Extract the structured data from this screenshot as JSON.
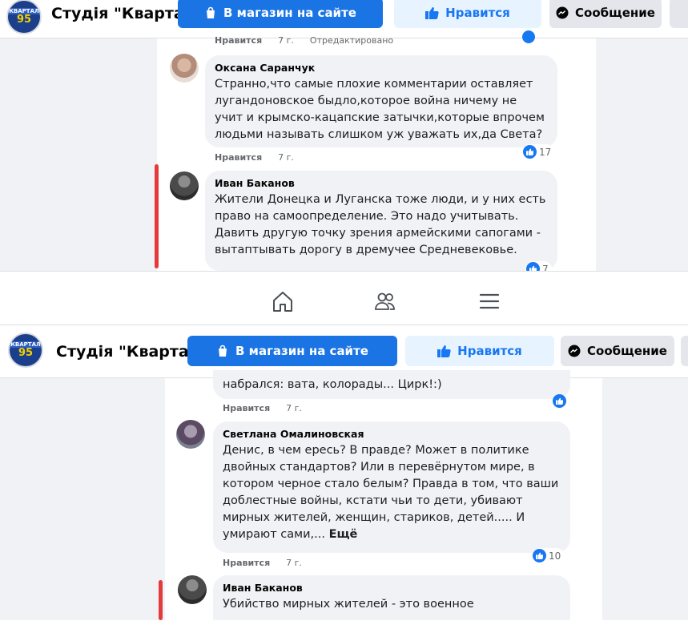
{
  "top_panel": {
    "header": {
      "page_name": "Студія \"Кварта...",
      "logo_line1": "КВАРТАЛ",
      "logo_line2": "95",
      "shop_button": "В магазин на сайте",
      "like_button": "Нравится",
      "message_button": "Сообщение"
    },
    "prev_meta": {
      "like": "Нравится",
      "time": "7 г.",
      "edited": "Отредактировано"
    },
    "comments": [
      {
        "author": "Оксана Саранчук",
        "text": "Странно,что самые плохие комментарии оставляет лугандоновское быдло,которое война ничему не учит и крымско-кацапские затычки,которые впрочем людьми называть слишком уж уважать их,да Света?",
        "like": "Нравится",
        "time": "7 г.",
        "reactions": "17"
      },
      {
        "author": "Иван Баканов",
        "text": "Жители Донецка и Луганска тоже люди, и у них есть право на самоопределение. Это надо учитывать. Давить другую точку зрения армейскими сапогами - вытаптывать дорогу в дремучее Средневековье.",
        "like": "Нравится",
        "time": "7 г.",
        "reactions": "7"
      }
    ]
  },
  "bottom_panel": {
    "header": {
      "page_name": "Студія \"Кварта...",
      "logo_line1": "КВАРТАЛ",
      "logo_line2": "95",
      "shop_button": "В магазин на сайте",
      "like_button": "Нравится",
      "message_button": "Сообщение"
    },
    "partial_comment": {
      "text": "набрался: вата, колорады... Цирк!:)",
      "like": "Нравится",
      "time": "7 г."
    },
    "comments": [
      {
        "author": "Светлана Омалиновская",
        "text": "Денис, в чем ересь? В правде? Может в политике двойных стандартов? Или в перевёрнутом мире, в котором черное стало белым? Правда в том, что ваши доблестные войны, кстати чьи то дети, убивают мирных жителей, женщин, стариков, детей..... И умирают сами,...",
        "more": "Ещё",
        "like": "Нравится",
        "time": "7 г.",
        "reactions": "10"
      },
      {
        "author": "Иван Баканов",
        "text": "Убийство мирных жителей - это военное"
      }
    ]
  },
  "colors": {
    "accent": "#1b74e4",
    "light_accent": "#e7f3ff",
    "bubble": "#f0f2f5",
    "red_marker": "#e33b3b"
  },
  "icons": [
    "shopping-bag-icon",
    "thumbs-up-icon",
    "messenger-icon",
    "home-icon",
    "friends-icon",
    "menu-icon"
  ]
}
